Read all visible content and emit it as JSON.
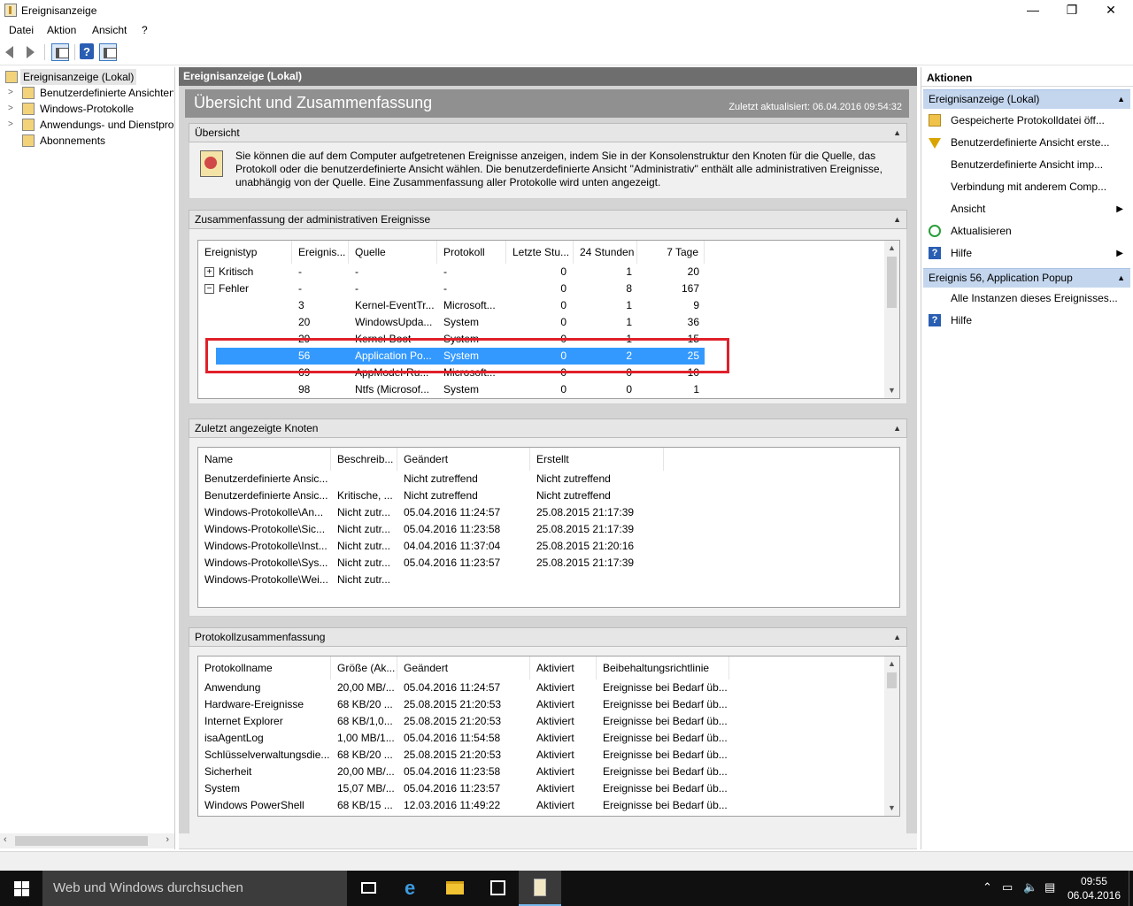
{
  "window": {
    "title": "Ereignisanzeige",
    "minimize": "—",
    "restore": "❐",
    "close": "✕"
  },
  "menu": {
    "items": [
      "Datei",
      "Aktion",
      "Ansicht",
      "?"
    ]
  },
  "toolbar": {
    "help_glyph": "?"
  },
  "tree": {
    "items": [
      {
        "label": "Ereignisanzeige (Lokal)",
        "expander": ""
      },
      {
        "label": "Benutzerdefinierte Ansichten",
        "expander": ">"
      },
      {
        "label": "Windows-Protokolle",
        "expander": ">"
      },
      {
        "label": "Anwendungs- und Dienstprotokolle",
        "expander": ">"
      },
      {
        "label": "Abonnements",
        "expander": ""
      }
    ]
  },
  "center": {
    "header": "Ereignisanzeige (Lokal)",
    "banner_title": "Übersicht und Zusammenfassung",
    "last_updated": "Zuletzt aktualisiert: 06.04.2016 09:54:32",
    "overview": {
      "title": "Übersicht",
      "text": "Sie können die auf dem Computer aufgetretenen Ereignisse anzeigen, indem Sie in der Konsolenstruktur den Knoten für die Quelle, das Protokoll oder die benutzerdefinierte Ansicht wählen. Die benutzerdefinierte Ansicht \"Administrativ\" enthält alle administrativen Ereignisse, unabhängig von der Quelle. Eine Zusammenfassung aller Protokolle wird unten angezeigt."
    },
    "admin_summary": {
      "title": "Zusammenfassung der administrativen Ereignisse",
      "columns": [
        "Ereignistyp",
        "Ereignis...",
        "Quelle",
        "Protokoll",
        "Letzte Stu...",
        "24 Stunden",
        "7 Tage"
      ],
      "rows": [
        {
          "type": "Kritisch",
          "expander": "+",
          "id": "-",
          "source": "-",
          "log": "-",
          "h1": "0",
          "h24": "1",
          "d7": "20"
        },
        {
          "type": "Fehler",
          "expander": "−",
          "id": "-",
          "source": "-",
          "log": "-",
          "h1": "0",
          "h24": "8",
          "d7": "167"
        },
        {
          "type": "",
          "expander": "",
          "id": "3",
          "source": "Kernel-EventTr...",
          "log": "Microsoft...",
          "h1": "0",
          "h24": "1",
          "d7": "9"
        },
        {
          "type": "",
          "expander": "",
          "id": "20",
          "source": "WindowsUpda...",
          "log": "System",
          "h1": "0",
          "h24": "1",
          "d7": "36"
        },
        {
          "type": "",
          "expander": "",
          "id": "29",
          "source": "Kernel-Boot",
          "log": "System",
          "h1": "0",
          "h24": "1",
          "d7": "15"
        },
        {
          "type": "",
          "expander": "",
          "id": "56",
          "source": "Application Po...",
          "log": "System",
          "h1": "0",
          "h24": "2",
          "d7": "25"
        },
        {
          "type": "",
          "expander": "",
          "id": "69",
          "source": "AppModel-Ru...",
          "log": "Microsoft...",
          "h1": "0",
          "h24": "0",
          "d7": "10"
        },
        {
          "type": "",
          "expander": "",
          "id": "98",
          "source": "Ntfs (Microsof...",
          "log": "System",
          "h1": "0",
          "h24": "0",
          "d7": "1"
        }
      ]
    },
    "recent_nodes": {
      "title": "Zuletzt angezeigte Knoten",
      "columns": [
        "Name",
        "Beschreib...",
        "Geändert",
        "Erstellt"
      ],
      "rows": [
        {
          "name": "Benutzerdefinierte Ansic...",
          "desc": "",
          "changed": "Nicht zutreffend",
          "created": "Nicht zutreffend"
        },
        {
          "name": "Benutzerdefinierte Ansic...",
          "desc": "Kritische, ...",
          "changed": "Nicht zutreffend",
          "created": "Nicht zutreffend"
        },
        {
          "name": "Windows-Protokolle\\An...",
          "desc": "Nicht zutr...",
          "changed": "05.04.2016 11:24:57",
          "created": "25.08.2015 21:17:39"
        },
        {
          "name": "Windows-Protokolle\\Sic...",
          "desc": "Nicht zutr...",
          "changed": "05.04.2016 11:23:58",
          "created": "25.08.2015 21:17:39"
        },
        {
          "name": "Windows-Protokolle\\Inst...",
          "desc": "Nicht zutr...",
          "changed": "04.04.2016 11:37:04",
          "created": "25.08.2015 21:20:16"
        },
        {
          "name": "Windows-Protokolle\\Sys...",
          "desc": "Nicht zutr...",
          "changed": "05.04.2016 11:23:57",
          "created": "25.08.2015 21:17:39"
        },
        {
          "name": "Windows-Protokolle\\Wei...",
          "desc": "Nicht zutr...",
          "changed": "",
          "created": ""
        }
      ]
    },
    "log_summary": {
      "title": "Protokollzusammenfassung",
      "columns": [
        "Protokollname",
        "Größe (Ak...",
        "Geändert",
        "Aktiviert",
        "Beibehaltungsrichtlinie"
      ],
      "rows": [
        {
          "name": "Anwendung",
          "size": "20,00 MB/...",
          "changed": "05.04.2016 11:24:57",
          "enabled": "Aktiviert",
          "policy": "Ereignisse bei Bedarf üb..."
        },
        {
          "name": "Hardware-Ereignisse",
          "size": "68 KB/20 ...",
          "changed": "25.08.2015 21:20:53",
          "enabled": "Aktiviert",
          "policy": "Ereignisse bei Bedarf üb..."
        },
        {
          "name": "Internet Explorer",
          "size": "68 KB/1,0...",
          "changed": "25.08.2015 21:20:53",
          "enabled": "Aktiviert",
          "policy": "Ereignisse bei Bedarf üb..."
        },
        {
          "name": "isaAgentLog",
          "size": "1,00 MB/1...",
          "changed": "05.04.2016 11:54:58",
          "enabled": "Aktiviert",
          "policy": "Ereignisse bei Bedarf üb..."
        },
        {
          "name": "Schlüsselverwaltungsdie...",
          "size": "68 KB/20 ...",
          "changed": "25.08.2015 21:20:53",
          "enabled": "Aktiviert",
          "policy": "Ereignisse bei Bedarf üb..."
        },
        {
          "name": "Sicherheit",
          "size": "20,00 MB/...",
          "changed": "05.04.2016 11:23:58",
          "enabled": "Aktiviert",
          "policy": "Ereignisse bei Bedarf üb..."
        },
        {
          "name": "System",
          "size": "15,07 MB/...",
          "changed": "05.04.2016 11:23:57",
          "enabled": "Aktiviert",
          "policy": "Ereignisse bei Bedarf üb..."
        },
        {
          "name": "Windows PowerShell",
          "size": "68 KB/15 ...",
          "changed": "12.03.2016 11:49:22",
          "enabled": "Aktiviert",
          "policy": "Ereignisse bei Bedarf üb..."
        }
      ]
    }
  },
  "actions": {
    "title": "Aktionen",
    "group1": {
      "title": "Ereignisanzeige (Lokal)",
      "items": [
        {
          "label": "Gespeicherte Protokolldatei öff...",
          "icon": "open-log-icon",
          "submenu": ""
        },
        {
          "label": "Benutzerdefinierte Ansicht erste...",
          "icon": "filter-icon",
          "submenu": ""
        },
        {
          "label": "Benutzerdefinierte Ansicht imp...",
          "icon": "",
          "submenu": ""
        },
        {
          "label": "Verbindung mit anderem Comp...",
          "icon": "",
          "submenu": ""
        },
        {
          "label": "Ansicht",
          "icon": "",
          "submenu": "▶"
        },
        {
          "label": "Aktualisieren",
          "icon": "refresh-icon",
          "submenu": ""
        },
        {
          "label": "Hilfe",
          "icon": "help-icon",
          "submenu": "▶"
        }
      ]
    },
    "group2": {
      "title": "Ereignis 56, Application Popup",
      "items": [
        {
          "label": "Alle Instanzen dieses Ereignisses...",
          "icon": "",
          "submenu": ""
        },
        {
          "label": "Hilfe",
          "icon": "help-icon",
          "submenu": ""
        }
      ]
    }
  },
  "taskbar": {
    "search_placeholder": "Web und Windows durchsuchen",
    "time": "09:55",
    "date": "06.04.2016"
  },
  "colors": {
    "selection": "#3399ff",
    "highlight_box": "#e0202a",
    "action_group": "#c4d6ee"
  }
}
